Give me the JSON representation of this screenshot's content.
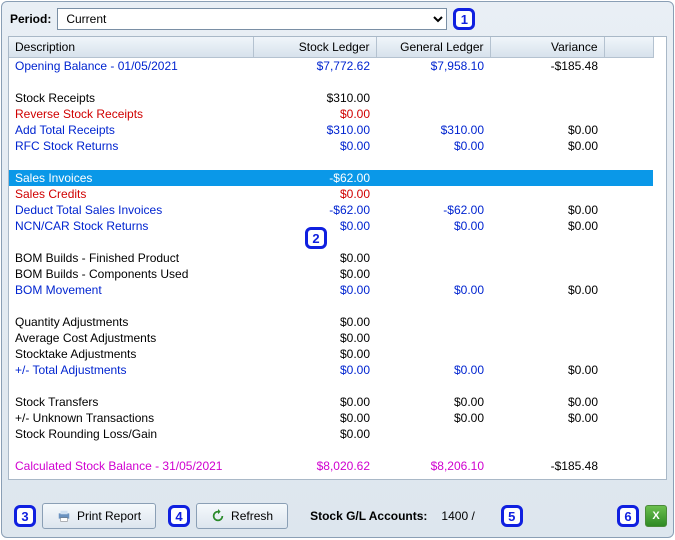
{
  "period": {
    "label": "Period:",
    "value": "Current"
  },
  "columns": {
    "desc": "Description",
    "stock": "Stock Ledger",
    "gl": "General Ledger",
    "var": "Variance"
  },
  "rows": [
    {
      "desc": "Opening Balance - 01/05/2021",
      "sl": "$7,772.62",
      "gl": "$7,958.10",
      "var": "-$185.48",
      "cls": "c-blue"
    },
    {
      "blank": true
    },
    {
      "desc": "Stock Receipts",
      "sl": "$310.00",
      "gl": "",
      "var": "",
      "cls": "c-black"
    },
    {
      "desc": "Reverse Stock Receipts",
      "sl": "$0.00",
      "gl": "",
      "var": "",
      "cls": "c-red"
    },
    {
      "desc": "Add Total Receipts",
      "sl": "$310.00",
      "gl": "$310.00",
      "var": "$0.00",
      "cls": "c-blue"
    },
    {
      "desc": "RFC Stock Returns",
      "sl": "$0.00",
      "gl": "$0.00",
      "var": "$0.00",
      "cls": "c-blue"
    },
    {
      "blank": true
    },
    {
      "desc": "Sales Invoices",
      "sl": "-$62.00",
      "gl": "",
      "var": "",
      "cls": "c-black",
      "selected": true
    },
    {
      "desc": "Sales Credits",
      "sl": "$0.00",
      "gl": "",
      "var": "",
      "cls": "c-red"
    },
    {
      "desc": "Deduct Total Sales Invoices",
      "sl": "-$62.00",
      "gl": "-$62.00",
      "var": "$0.00",
      "cls": "c-blue"
    },
    {
      "desc": "NCN/CAR Stock Returns",
      "sl": "$0.00",
      "gl": "$0.00",
      "var": "$0.00",
      "cls": "c-blue"
    },
    {
      "blank": true
    },
    {
      "desc": "BOM Builds - Finished Product",
      "sl": "$0.00",
      "gl": "",
      "var": "",
      "cls": "c-black"
    },
    {
      "desc": "BOM Builds - Components Used",
      "sl": "$0.00",
      "gl": "",
      "var": "",
      "cls": "c-black"
    },
    {
      "desc": "BOM Movement",
      "sl": "$0.00",
      "gl": "$0.00",
      "var": "$0.00",
      "cls": "c-blue"
    },
    {
      "blank": true
    },
    {
      "desc": "Quantity Adjustments",
      "sl": "$0.00",
      "gl": "",
      "var": "",
      "cls": "c-black"
    },
    {
      "desc": "Average Cost Adjustments",
      "sl": "$0.00",
      "gl": "",
      "var": "",
      "cls": "c-black"
    },
    {
      "desc": "Stocktake Adjustments",
      "sl": "$0.00",
      "gl": "",
      "var": "",
      "cls": "c-black"
    },
    {
      "desc": "+/- Total Adjustments",
      "sl": "$0.00",
      "gl": "$0.00",
      "var": "$0.00",
      "cls": "c-blue"
    },
    {
      "blank": true
    },
    {
      "desc": "Stock Transfers",
      "sl": "$0.00",
      "gl": "$0.00",
      "var": "$0.00",
      "cls": "c-black"
    },
    {
      "desc": "+/- Unknown Transactions",
      "sl": "$0.00",
      "gl": "$0.00",
      "var": "$0.00",
      "cls": "c-black"
    },
    {
      "desc": "Stock Rounding Loss/Gain",
      "sl": "$0.00",
      "gl": "",
      "var": "",
      "cls": "c-black"
    },
    {
      "blank": true
    },
    {
      "desc": "Calculated Stock Balance - 31/05/2021",
      "sl": "$8,020.62",
      "gl": "$8,206.10",
      "var": "-$185.48",
      "cls": "c-mag"
    },
    {
      "blank": true
    }
  ],
  "footer": {
    "print": "Print Report",
    "refresh": "Refresh",
    "accounts_label": "Stock G/L Accounts:",
    "accounts_value": "1400   /"
  },
  "annotations": {
    "a1": "1",
    "a2": "2",
    "a3": "3",
    "a4": "4",
    "a5": "5",
    "a6": "6"
  }
}
